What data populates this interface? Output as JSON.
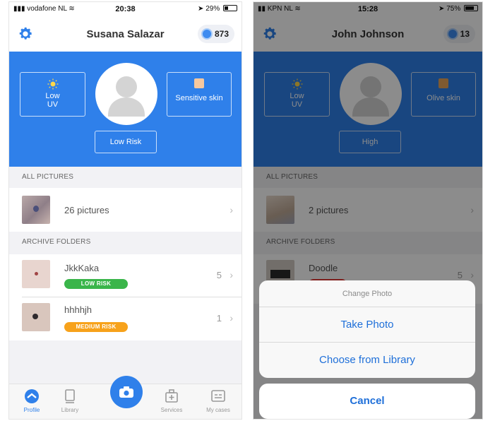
{
  "left": {
    "status": {
      "carrier": "vodafone NL",
      "time": "20:38",
      "battery": "29%",
      "battery_level": 0.29
    },
    "header": {
      "title": "Susana Salazar",
      "coins": "873"
    },
    "profile": {
      "uv_label": "Low UV",
      "skin_label": "Sensitive skin",
      "risk_label": "Low Risk"
    },
    "all_pictures": {
      "heading": "ALL PICTURES",
      "label": "26 pictures"
    },
    "archive": {
      "heading": "ARCHIVE FOLDERS",
      "folders": [
        {
          "name": "JkkKaka",
          "risk": "LOW RISK",
          "count": "5"
        },
        {
          "name": "hhhhjh",
          "risk": "MEDIUM RISK",
          "count": "1"
        }
      ]
    },
    "tabs": {
      "profile": "Profile",
      "library": "Library",
      "services": "Services",
      "cases": "My cases"
    }
  },
  "right": {
    "status": {
      "carrier": "KPN NL",
      "time": "15:28",
      "battery": "75%",
      "battery_level": 0.75
    },
    "header": {
      "title": "John Johnson",
      "coins": "13"
    },
    "profile": {
      "uv_label": "Low UV",
      "skin_label": "Olive skin",
      "risk_label": "High"
    },
    "all_pictures": {
      "heading": "ALL PICTURES",
      "label": "2 pictures"
    },
    "archive": {
      "heading": "ARCHIVE FOLDERS",
      "folders": [
        {
          "name": "Doodle",
          "count": "5"
        }
      ]
    },
    "action_sheet": {
      "title": "Change Photo",
      "take_photo": "Take Photo",
      "choose_library": "Choose from Library",
      "cancel": "Cancel"
    }
  },
  "colors": {
    "brand_blue": "#2f80ea",
    "low_risk": "#3ab54a",
    "medium_risk": "#f7a21b",
    "high_risk": "#e53935"
  }
}
